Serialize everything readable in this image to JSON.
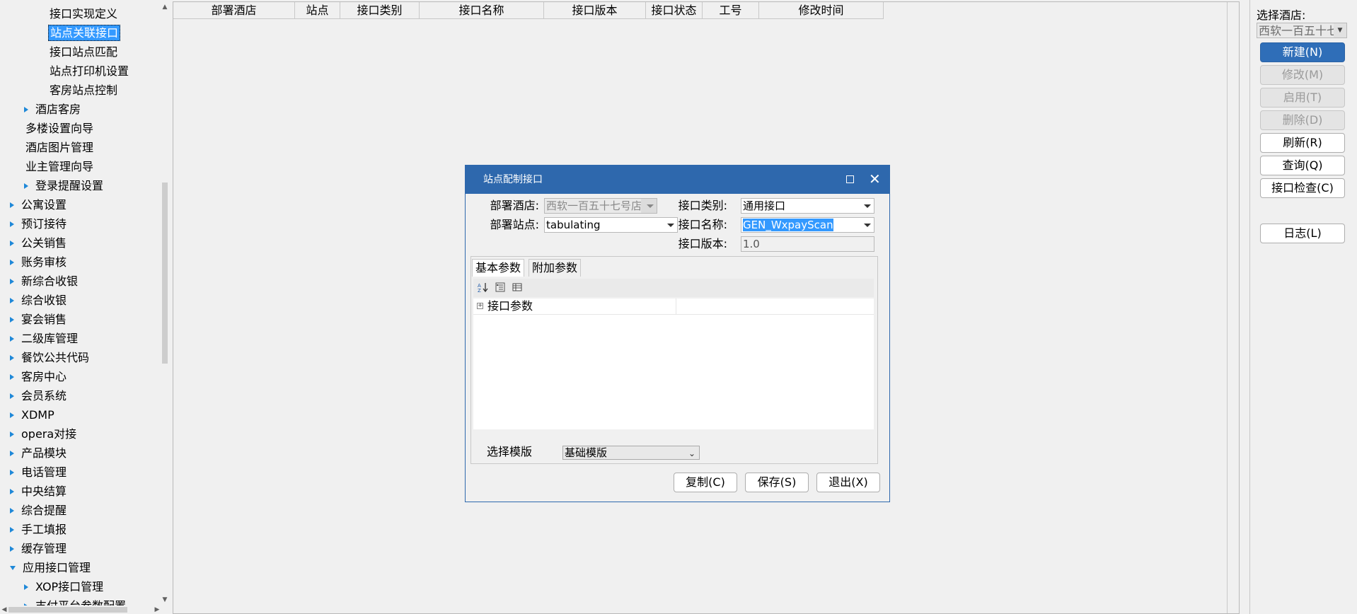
{
  "tree": {
    "items": [
      {
        "label": "接口实现定义",
        "arrow": "none"
      },
      {
        "label": "站点关联接口",
        "arrow": "none",
        "selected": true
      },
      {
        "label": "接口站点匹配",
        "arrow": "none"
      },
      {
        "label": "站点打印机设置",
        "arrow": "none"
      },
      {
        "label": "客房站点控制",
        "arrow": "none"
      },
      {
        "label": "酒店客房",
        "arrow": "right"
      },
      {
        "label": "多楼设置向导",
        "arrow": "none"
      },
      {
        "label": "酒店图片管理",
        "arrow": "none"
      },
      {
        "label": "业主管理向导",
        "arrow": "none"
      },
      {
        "label": "登录提醒设置",
        "arrow": "right"
      },
      {
        "label": "公寓设置",
        "arrow": "right"
      },
      {
        "label": "预订接待",
        "arrow": "right"
      },
      {
        "label": "公关销售",
        "arrow": "right"
      },
      {
        "label": "账务审核",
        "arrow": "right"
      },
      {
        "label": "新综合收银",
        "arrow": "right"
      },
      {
        "label": "综合收银",
        "arrow": "right"
      },
      {
        "label": "宴会销售",
        "arrow": "right"
      },
      {
        "label": "二级库管理",
        "arrow": "right"
      },
      {
        "label": "餐饮公共代码",
        "arrow": "right"
      },
      {
        "label": "客房中心",
        "arrow": "right"
      },
      {
        "label": "会员系统",
        "arrow": "right"
      },
      {
        "label": "XDMP",
        "arrow": "right"
      },
      {
        "label": "opera对接",
        "arrow": "right"
      },
      {
        "label": "产品模块",
        "arrow": "right"
      },
      {
        "label": "电话管理",
        "arrow": "right"
      },
      {
        "label": "中央结算",
        "arrow": "right"
      },
      {
        "label": "综合提醒",
        "arrow": "right"
      },
      {
        "label": "手工填报",
        "arrow": "right"
      },
      {
        "label": "缓存管理",
        "arrow": "right"
      },
      {
        "label": "应用接口管理",
        "arrow": "down"
      },
      {
        "label": "XOP接口管理",
        "arrow": "right"
      },
      {
        "label": "支付平台参数配置",
        "arrow": "right"
      }
    ]
  },
  "grid": {
    "columns": [
      "部署酒店",
      "站点",
      "接口类别",
      "接口名称",
      "接口版本",
      "接口状态",
      "工号",
      "修改时间"
    ]
  },
  "right_panel": {
    "hotel_label": "选择酒店:",
    "hotel_value": "西软一百五十七号店",
    "buttons": {
      "new": "新建(N)",
      "modify": "修改(M)",
      "enable": "启用(T)",
      "delete": "删除(D)",
      "refresh": "刷新(R)",
      "query": "查询(Q)",
      "check": "接口检查(C)",
      "log": "日志(L)"
    }
  },
  "dialog": {
    "title": "站点配制接口",
    "labels": {
      "hotel": "部署酒店:",
      "site": "部署站点:",
      "category": "接口类别:",
      "name": "接口名称:",
      "version": "接口版本:"
    },
    "values": {
      "hotel": "西软一百五十七号店",
      "site": "tabulating",
      "category": "通用接口",
      "name": "GEN_WxpayScan",
      "version": "1.0"
    },
    "tabs": {
      "basic": "基本参数",
      "extra": "附加参数"
    },
    "property_grid": {
      "row": "接口参数"
    },
    "template": {
      "label": "选择模版",
      "value": "基础模版"
    },
    "buttons": {
      "copy": "复制(C)",
      "save": "保存(S)",
      "exit": "退出(X)"
    }
  },
  "colors": {
    "accent": "#2e68ad",
    "selection": "#3399ff",
    "tree_arrow": "#1e88d8"
  }
}
